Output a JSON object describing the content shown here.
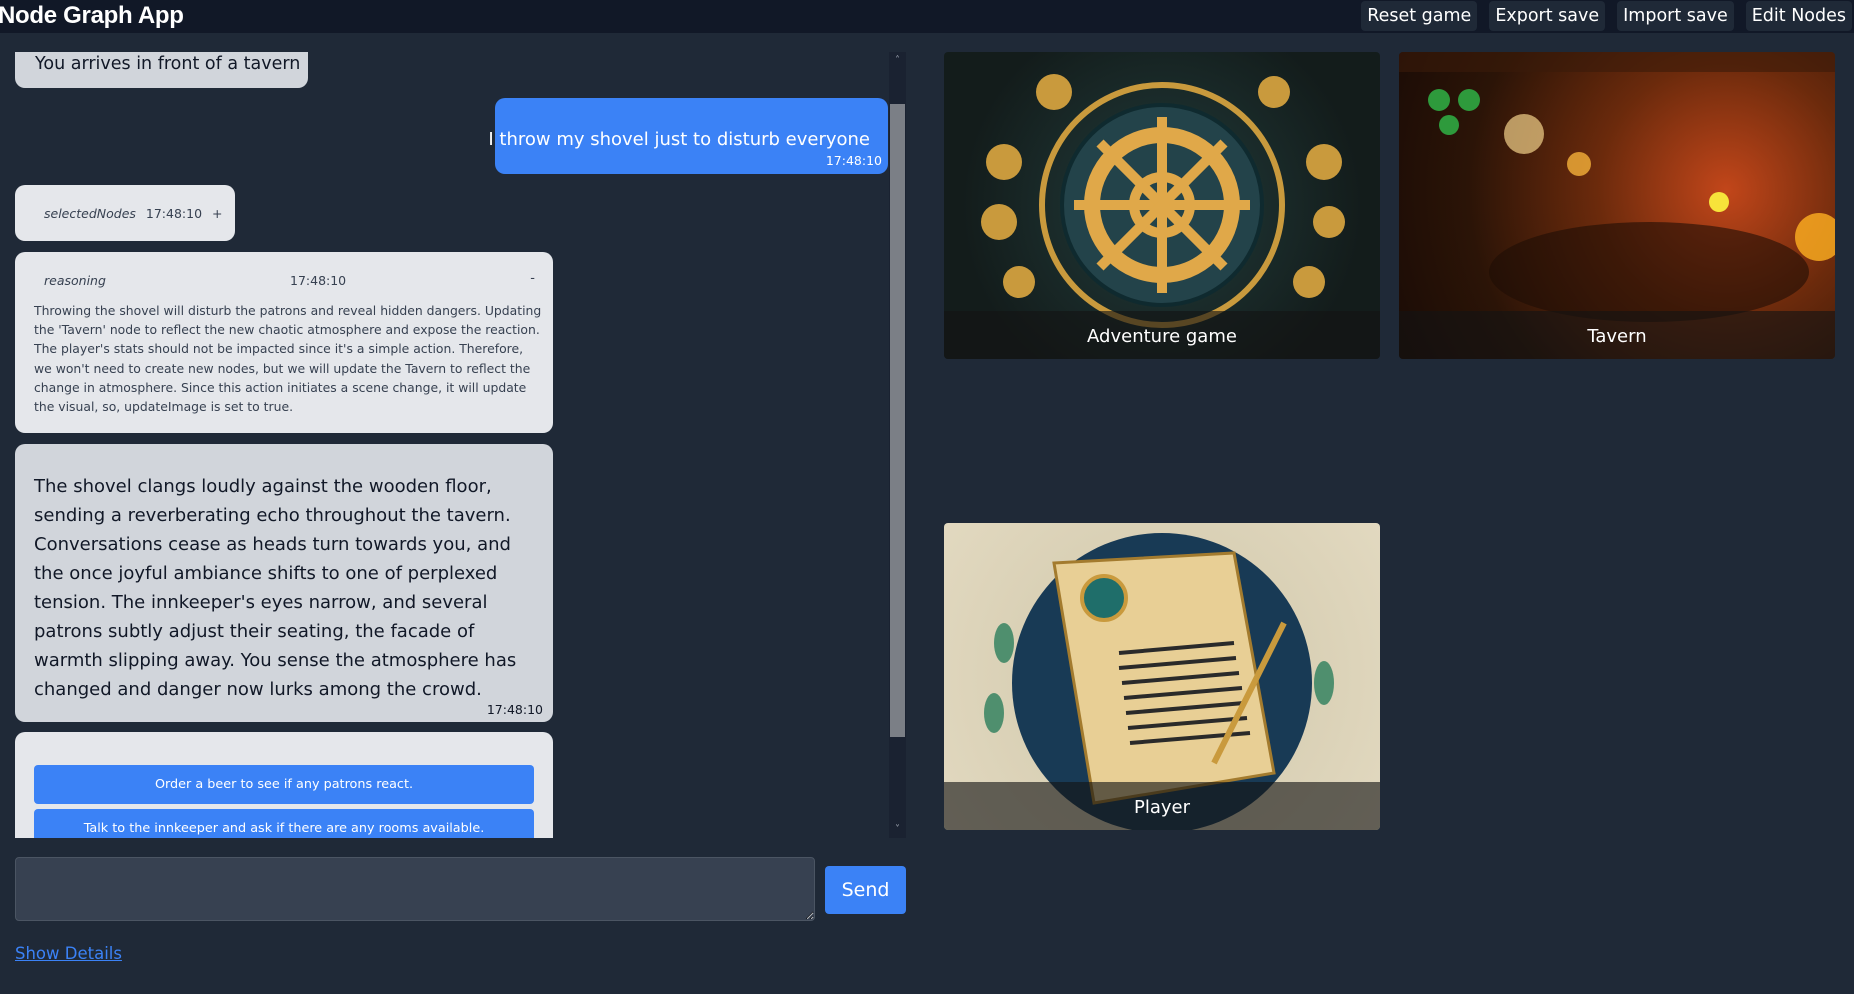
{
  "header": {
    "title": "Node Graph App",
    "buttons": [
      "Reset game",
      "Export save",
      "Import save",
      "Edit Nodes"
    ]
  },
  "chat": {
    "previous_message": "You arrives in front of a tavern",
    "user_message": {
      "text": "I throw my shovel just to disturb everyone",
      "time": "17:48:10"
    },
    "selected_nodes": {
      "label": "selectedNodes",
      "time": "17:48:10",
      "toggle": "+"
    },
    "reasoning": {
      "label": "reasoning",
      "time": "17:48:10",
      "toggle": "-",
      "text": "Throwing the shovel will disturb the patrons and reveal hidden dangers. Updating the 'Tavern' node to reflect the new chaotic atmosphere and expose the reaction. The player's stats should not be impacted since it's a simple action. Therefore, we won't need to create new nodes, but we will update the Tavern to reflect the change in atmosphere. Since this action initiates a scene change, it will update the visual, so, updateImage is set to true."
    },
    "narrative": {
      "text": "The shovel clangs loudly against the wooden floor, sending a reverberating echo throughout the tavern. Conversations cease as heads turn towards you, and the once joyful ambiance shifts to one of perplexed tension. The innkeeper's eyes narrow, and several patrons subtly adjust their seating, the facade of warmth slipping away. You sense the atmosphere has changed and danger now lurks among the crowd.",
      "time": "17:48:10"
    },
    "options": [
      "Order a beer to see if any patrons react.",
      "Talk to the innkeeper and ask if there are any rooms available."
    ],
    "scroll": {
      "up_icon": "˄",
      "down_icon": "˅"
    }
  },
  "input": {
    "value": "",
    "placeholder": ""
  },
  "send_label": "Send",
  "show_details_label": "Show Details",
  "nodes": [
    {
      "name": "Adventure game"
    },
    {
      "name": "Tavern"
    },
    {
      "name": "Player"
    }
  ]
}
